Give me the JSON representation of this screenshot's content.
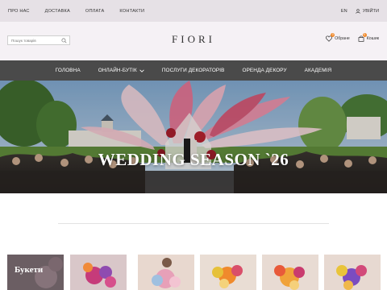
{
  "topbar": {
    "links": [
      "ПРО НАС",
      "ДОСТАВКА",
      "ОПЛАТА",
      "КОНТАКТИ"
    ],
    "language": "EN",
    "login_label": "УВІЙТИ"
  },
  "header": {
    "search_placeholder": "Пошук товарів",
    "logo": "FIORI",
    "favorites_label": "Обране",
    "favorites_count": "0",
    "cart_label": "Кошик",
    "cart_count": "0"
  },
  "nav": {
    "items": [
      {
        "label": "Головна"
      },
      {
        "label": "Онлайн-бутік",
        "has_dropdown": true
      },
      {
        "label": "Послуги декораторів"
      },
      {
        "label": "Оренда декору"
      },
      {
        "label": "Академія"
      }
    ]
  },
  "hero": {
    "title": "WEDDING SEASON `26"
  },
  "categories": {
    "items": [
      {
        "label": "Букети",
        "color": "#6b5e63"
      },
      {
        "label": "",
        "color": "#d9c7c9"
      },
      {
        "label": "",
        "color": "#e8d8cf"
      },
      {
        "label": "",
        "color": "#e9ddd4"
      },
      {
        "label": "",
        "color": "#e8dbd3"
      },
      {
        "label": "",
        "color": "#e7d9d1"
      }
    ]
  },
  "colors": {
    "topbar_bg": "#e6e1e6",
    "header_bg": "#f5f1f5",
    "nav_bg": "#4a4a4a",
    "badge": "#f08a2c"
  }
}
